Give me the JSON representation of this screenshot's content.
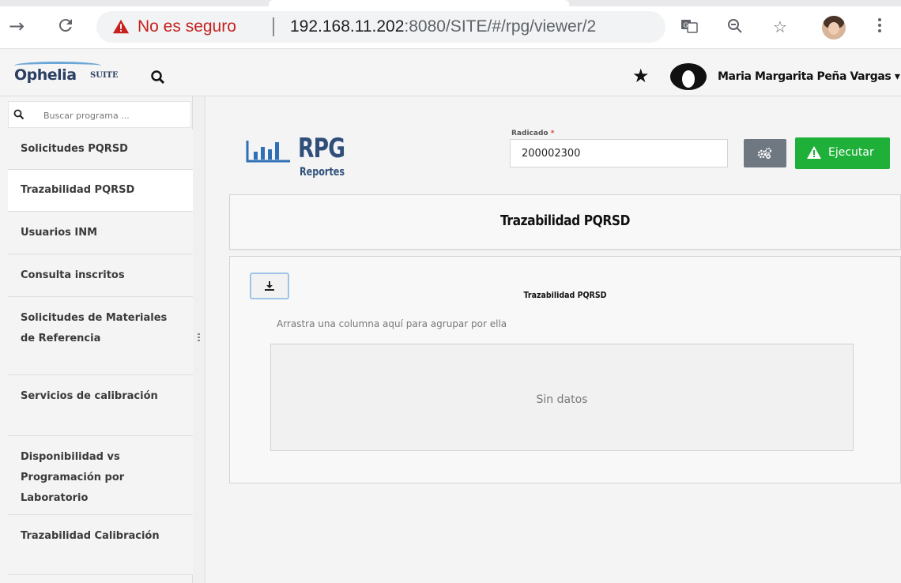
{
  "browser": {
    "security_label": "No es seguro",
    "url_host": "192.168.11.202",
    "url_rest": ":8080/SITE/#/rpg/viewer/2"
  },
  "header": {
    "logo_main": "Ophelia",
    "logo_suite": "SUITE",
    "user_name": "Maria Margarita Peña Vargas"
  },
  "sidebar": {
    "search_placeholder": "Buscar programa ...",
    "items": [
      {
        "label": "Solicitudes PQRSD"
      },
      {
        "label": "Trazabilidad PQRSD"
      },
      {
        "label": "Usuarios INM"
      },
      {
        "label": "Consulta inscritos"
      },
      {
        "label": "Solicitudes de Materiales de Referencia"
      },
      {
        "label": "Servicios de calibración"
      },
      {
        "label": "Disponibilidad vs Programación por Laboratorio"
      },
      {
        "label": "Trazabilidad Calibración"
      }
    ],
    "active_index": 1
  },
  "rpg": {
    "title": "RPG",
    "subtitle": "Reportes"
  },
  "form": {
    "radicado_label": "Radicado",
    "required_mark": "*",
    "radicado_value": "200002300",
    "run_label": "Ejecutar"
  },
  "report": {
    "title": "Trazabilidad PQRSD",
    "grid_title": "Trazabilidad PQRSD",
    "group_hint": "Arrastra una columna aquí para agrupar por ella",
    "empty_text": "Sin datos"
  },
  "colors": {
    "run_button": "#1fb03a",
    "config_button": "#6f7780",
    "warning_red": "#c5221f",
    "brand_blue": "#2f4f7a"
  }
}
